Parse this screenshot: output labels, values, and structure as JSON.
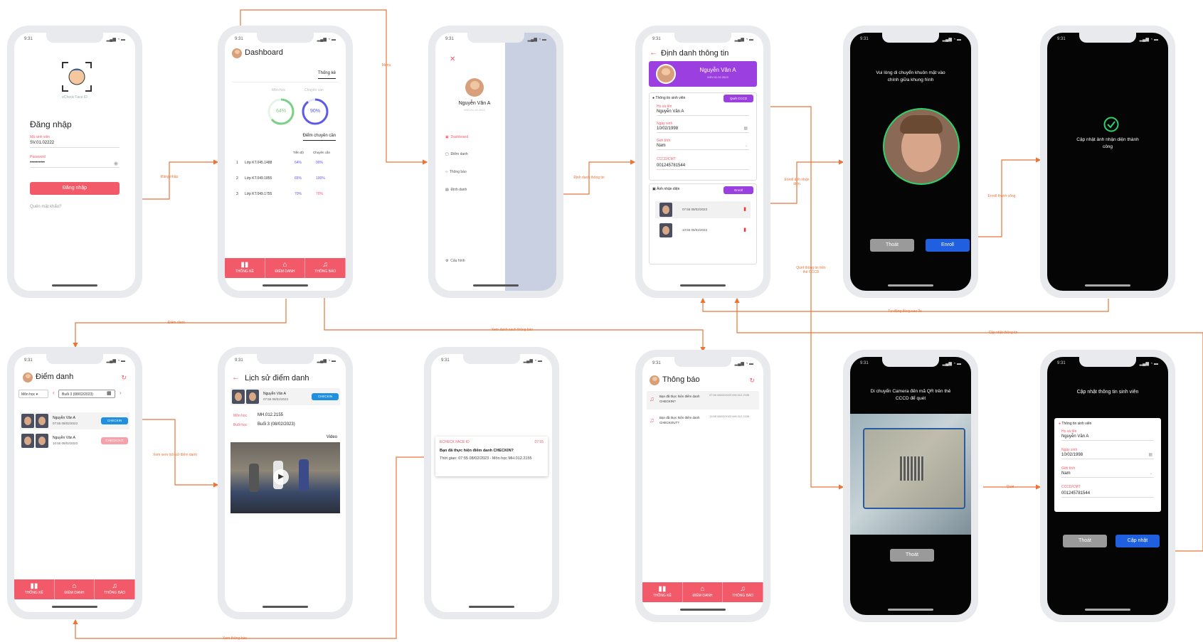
{
  "time": "9:31",
  "flows": {
    "dang_nhap": "Đăng nhập",
    "menu": "Menu",
    "dinh_danh_thong_tin": "Định danh thông tin",
    "enroll_anh": "Enroll ảnh nhận diện",
    "enroll_thanh_cong": "Enroll thành công",
    "quet_thong_tin": "Quét thông tin trên thẻ CCCD",
    "tu_dong_dong": "Tự động đóng sau 3s",
    "cap_nhat_thong_tin": "Cập nhật thông tin",
    "diem_danh": "Điểm danh",
    "xem_danh_sach": "Xem danh sách thông báo",
    "xem_lich_su": "Xem xem lịch sử điểm danh",
    "xem_thong_bao": "Xem thông báo",
    "quet": "Quét"
  },
  "login": {
    "brand": "eCheck Face ID",
    "title": "Đăng nhập",
    "student_id_label": "Mã sinh viên",
    "student_id_value": "SV.01.02222",
    "password_label": "Password",
    "password_value": "••••••••••",
    "submit": "Đăng nhập",
    "forgot": "Quên mật khẩu?"
  },
  "dashboard": {
    "title": "Dashboard",
    "tab": "Thống kê",
    "gauge1_label": "Môn học",
    "gauge1_value": "64%",
    "gauge2_label": "Chuyên cần",
    "gauge2_value": "90%",
    "table_title": "Điểm chuyên cần",
    "col1": "Tiến độ",
    "col2": "Chuyên cần",
    "rows": [
      {
        "n": "1",
        "name": "Lớp KT.045.1488",
        "a": "64%",
        "b": "90%"
      },
      {
        "n": "2",
        "name": "Lớp KT.049.1855",
        "a": "65%",
        "b": "100%"
      },
      {
        "n": "3",
        "name": "Lớp KT.049.1755",
        "a": "70%",
        "b": "70%"
      }
    ]
  },
  "tabs": {
    "t1": "THỐNG KÊ",
    "t2": "ĐIỂM DANH",
    "t3": "THÔNG BÁO"
  },
  "menu": {
    "name": "Nguyễn Văn A",
    "code": "MSV.01.02.2023",
    "items": [
      "Dashboard",
      "Điểm danh",
      "Thông báo",
      "Định danh"
    ],
    "config": "Cấu hình"
  },
  "identify": {
    "title": "Định danh thông tin",
    "name": "Nguyễn Văn A",
    "code": "MSV.01.02.2023",
    "section1": "Thông tin sinh viên",
    "scan_btn": "Quét CCCD",
    "name_label": "Họ và tên",
    "name_value": "Nguyễn Văn A",
    "dob_label": "Ngày sinh",
    "dob_value": "10/02/1998",
    "gender_label": "Giới tính",
    "gender_value": "Nam",
    "id_label": "CCCD/CMT",
    "id_value": "001245781544",
    "section2": "Ảnh nhận diện",
    "enroll_btn": "Enroll",
    "photos": [
      "07:55 08/02/2023",
      "10:55 08/02/2023"
    ]
  },
  "face": {
    "instruction": "Vui lòng di chuyển khuôn mặt vào chính giữa khung hình",
    "exit": "Thoát",
    "enroll": "Enroll"
  },
  "success": {
    "message": "Cập nhật ảnh nhận diện thành công"
  },
  "attendance": {
    "title": "Điểm danh",
    "subject": "Môn học",
    "session": "Buổi 3 (08/02/2023)",
    "items": [
      {
        "name": "Nguyễn Văn A",
        "time": "07:55 08/02/2023",
        "status": "CHECKIN"
      },
      {
        "name": "Nguyễn Văn A",
        "time": "10:55 08/02/2023",
        "status": "CHECKOUT"
      }
    ]
  },
  "history": {
    "title": "Lịch sử điểm danh",
    "name": "Nguyễn Văn A",
    "time": "07:55 08/02/2023",
    "status": "CHECKIN",
    "subject_label": "Môn học",
    "subject_value": "MH.012.2155",
    "session_label": "Buổi học",
    "session_value": "Buổi 3 (08/02/2023)",
    "video": "Video"
  },
  "push": {
    "app": "ECHECK FACE ID",
    "time": "07:55",
    "title": "Bạn đã thực hiện điểm danh CHECKIN?",
    "body": "Thời gian: 07:55 08/02/2023 - Môn học MH.012.2155"
  },
  "notifications": {
    "title": "Thông báo",
    "items": [
      {
        "text": "Bạn đã thực hiện điểm danh CHECKIN?",
        "time": "07:55 08/02/2023 MH.012.2155"
      },
      {
        "text": "Bạn đã thực hiện điểm danh CHECKOUT?",
        "time": "13:55 08/02/2023 MH.012.2155"
      }
    ]
  },
  "qr": {
    "instruction": "Di chuyển Camera đến mã QR trên thẻ CCCD để quét",
    "exit": "Thoát"
  },
  "update": {
    "title": "Cập nhật thông tin sinh viên",
    "section": "Thông tin sinh viên",
    "name_label": "Họ và tên",
    "name_value": "Nguyễn Văn A",
    "dob_label": "Ngày sinh",
    "dob_value": "10/02/1998",
    "gender_label": "Giới tính",
    "gender_value": "Nam",
    "id_label": "CCCD/CMT",
    "id_value": "001245781544",
    "exit": "Thoát",
    "submit": "Cập nhật"
  },
  "colors": {
    "accent": "#f25a6a",
    "flow": "#e8763a",
    "purple": "#9b3fe0",
    "blue": "#1f5fe0"
  }
}
